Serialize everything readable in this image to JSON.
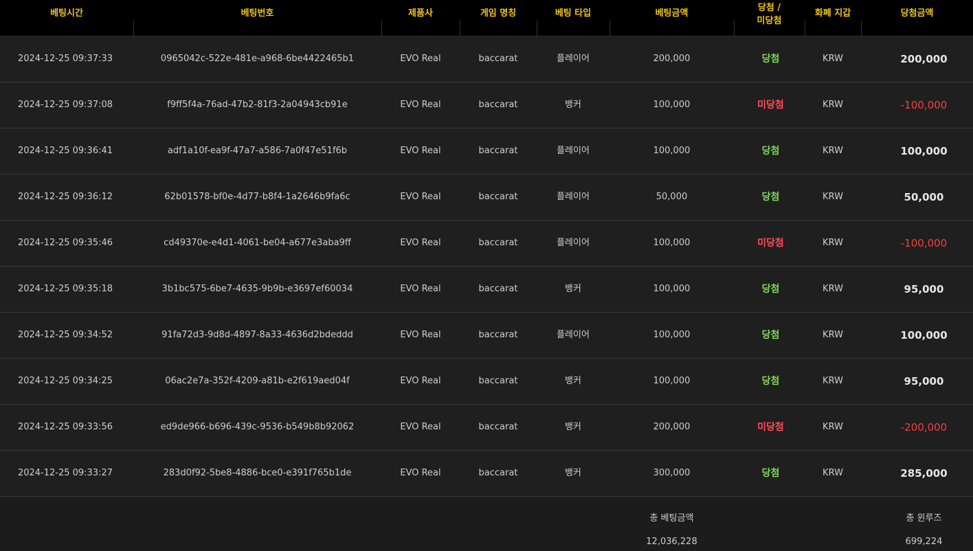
{
  "headers": {
    "time": "베팅시간",
    "bet_id": "베팅번호",
    "provider": "제품사",
    "game": "게임 명칭",
    "bet_type": "베팅 타입",
    "bet_amount": "베팅금액",
    "result_line1": "당첨 /",
    "result_line2": "미당첨",
    "currency": "화폐 지갑",
    "win_amount": "당첨금액"
  },
  "rows": [
    {
      "time": "2024-12-25 09:37:33",
      "bet_id": "0965042c-522e-481e-a968-6be4422465b1",
      "provider": "EVO Real",
      "game": "baccarat",
      "bet_type": "플레이어",
      "bet_amount": "200,000",
      "result": "당첨",
      "currency": "KRW",
      "win_amount": "200,000"
    },
    {
      "time": "2024-12-25 09:37:08",
      "bet_id": "f9ff5f4a-76ad-47b2-81f3-2a04943cb91e",
      "provider": "EVO Real",
      "game": "baccarat",
      "bet_type": "뱅커",
      "bet_amount": "100,000",
      "result": "미당첨",
      "currency": "KRW",
      "win_amount": "-100,000"
    },
    {
      "time": "2024-12-25 09:36:41",
      "bet_id": "adf1a10f-ea9f-47a7-a586-7a0f47e51f6b",
      "provider": "EVO Real",
      "game": "baccarat",
      "bet_type": "플레이어",
      "bet_amount": "100,000",
      "result": "당첨",
      "currency": "KRW",
      "win_amount": "100,000"
    },
    {
      "time": "2024-12-25 09:36:12",
      "bet_id": "62b01578-bf0e-4d77-b8f4-1a2646b9fa6c",
      "provider": "EVO Real",
      "game": "baccarat",
      "bet_type": "플레이어",
      "bet_amount": "50,000",
      "result": "당첨",
      "currency": "KRW",
      "win_amount": "50,000"
    },
    {
      "time": "2024-12-25 09:35:46",
      "bet_id": "cd49370e-e4d1-4061-be04-a677e3aba9ff",
      "provider": "EVO Real",
      "game": "baccarat",
      "bet_type": "플레이어",
      "bet_amount": "100,000",
      "result": "미당첨",
      "currency": "KRW",
      "win_amount": "-100,000"
    },
    {
      "time": "2024-12-25 09:35:18",
      "bet_id": "3b1bc575-6be7-4635-9b9b-e3697ef60034",
      "provider": "EVO Real",
      "game": "baccarat",
      "bet_type": "뱅커",
      "bet_amount": "100,000",
      "result": "당첨",
      "currency": "KRW",
      "win_amount": "95,000"
    },
    {
      "time": "2024-12-25 09:34:52",
      "bet_id": "91fa72d3-9d8d-4897-8a33-4636d2bdeddd",
      "provider": "EVO Real",
      "game": "baccarat",
      "bet_type": "플레이어",
      "bet_amount": "100,000",
      "result": "당첨",
      "currency": "KRW",
      "win_amount": "100,000"
    },
    {
      "time": "2024-12-25 09:34:25",
      "bet_id": "06ac2e7a-352f-4209-a81b-e2f619aed04f",
      "provider": "EVO Real",
      "game": "baccarat",
      "bet_type": "뱅커",
      "bet_amount": "100,000",
      "result": "당첨",
      "currency": "KRW",
      "win_amount": "95,000"
    },
    {
      "time": "2024-12-25 09:33:56",
      "bet_id": "ed9de966-b696-439c-9536-b549b8b92062",
      "provider": "EVO Real",
      "game": "baccarat",
      "bet_type": "뱅커",
      "bet_amount": "200,000",
      "result": "미당첨",
      "currency": "KRW",
      "win_amount": "-200,000"
    },
    {
      "time": "2024-12-25 09:33:27",
      "bet_id": "283d0f92-5be8-4886-bce0-e391f765b1de",
      "provider": "EVO Real",
      "game": "baccarat",
      "bet_type": "뱅커",
      "bet_amount": "300,000",
      "result": "당첨",
      "currency": "KRW",
      "win_amount": "285,000"
    }
  ],
  "totals": {
    "total_bet_label": "총 베팅금액",
    "total_bet_value": "12,036,228",
    "total_winloss_label": "총 윈루즈",
    "total_winloss_value": "699,224"
  },
  "colors": {
    "header_text": "#f0c419",
    "win": "#7ed957",
    "lose": "#ff4d5a"
  }
}
